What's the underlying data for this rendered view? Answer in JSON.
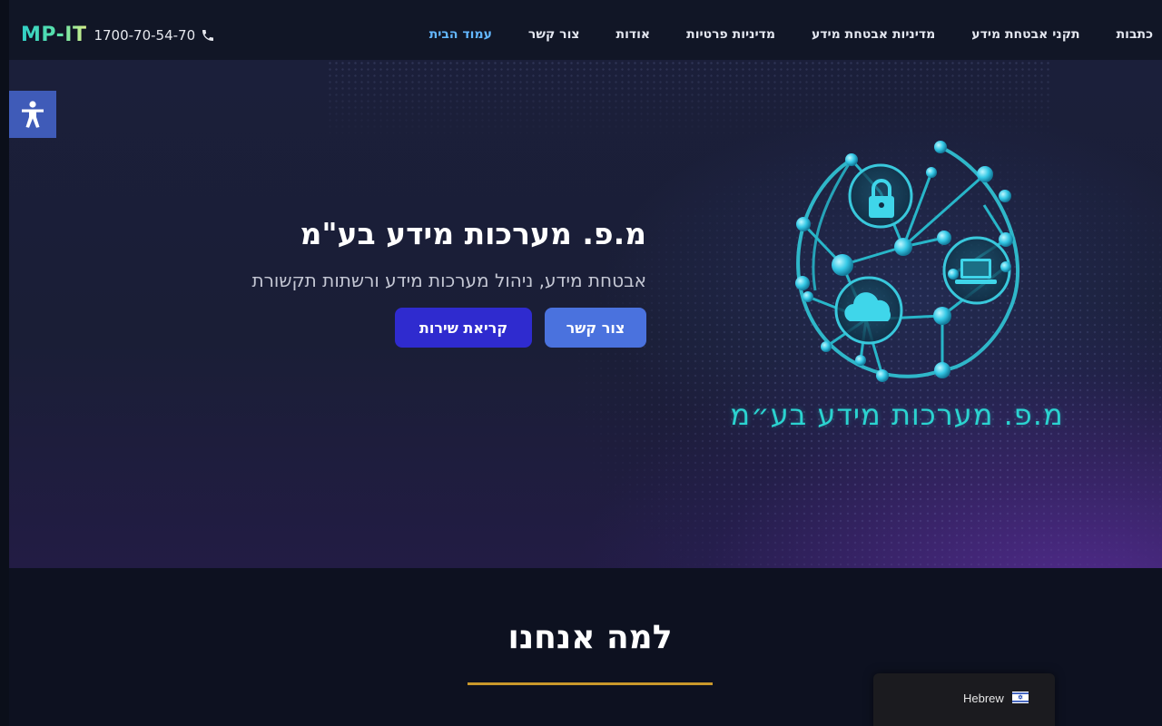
{
  "header": {
    "logo": "MP-IT",
    "phone": "1700-70-54-70",
    "nav": [
      {
        "label": "עמוד הבית",
        "active": true
      },
      {
        "label": "צור קשר",
        "active": false
      },
      {
        "label": "אודות",
        "active": false
      },
      {
        "label": "מדיניות פרטיות",
        "active": false
      },
      {
        "label": "מדיניות אבטחת מידע",
        "active": false
      },
      {
        "label": "תקני אבטחת מידע",
        "active": false
      },
      {
        "label": "כתבות",
        "active": false
      }
    ]
  },
  "hero": {
    "title": "מ.פ. מערכות מידע בע\"מ",
    "subtitle": "אבטחת מידע, ניהול מערכות מידע ורשתות תקשורת",
    "buttons": {
      "contact": "צור קשר",
      "service": "קריאת שירות"
    },
    "logo_text": "מ.פ. מערכות מידע בע״מ"
  },
  "why": {
    "title": "למה אנחנו"
  },
  "language": {
    "label": "Hebrew"
  },
  "colors": {
    "accent": "#4a72de",
    "service_button": "#2f2bcf",
    "nav_active": "#63b7ff",
    "divider": "#c9982b",
    "logo_teal": "#2bd3d0"
  },
  "icons": {
    "phone": "phone-icon",
    "accessibility": "accessibility-icon",
    "flag": "israel-flag-icon",
    "logo": "network-globe-icon"
  }
}
